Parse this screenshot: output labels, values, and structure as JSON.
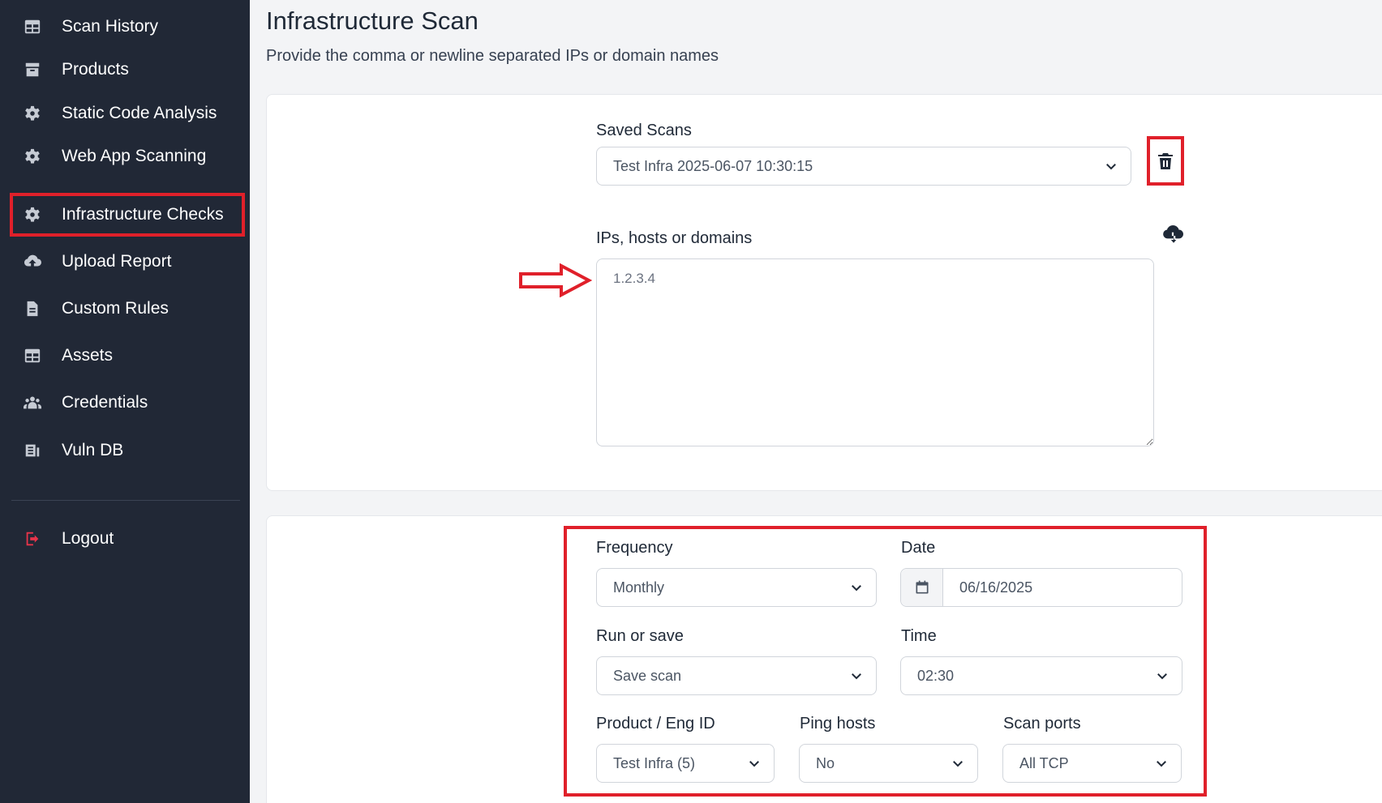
{
  "sidebar": {
    "items": [
      {
        "label": "Scan History",
        "icon": "table-icon"
      },
      {
        "label": "Products",
        "icon": "archive-icon"
      },
      {
        "label": "Static Code Analysis",
        "icon": "gear-icon"
      },
      {
        "label": "Web App Scanning",
        "icon": "gear-icon"
      },
      {
        "label": "Infrastructure Checks",
        "icon": "gear-icon",
        "active": true
      },
      {
        "label": "Upload Report",
        "icon": "cloud-upload-icon"
      },
      {
        "label": "Custom Rules",
        "icon": "file-icon"
      },
      {
        "label": "Assets",
        "icon": "table-icon"
      },
      {
        "label": "Credentials",
        "icon": "users-icon"
      },
      {
        "label": "Vuln DB",
        "icon": "database-icon"
      }
    ],
    "logout_label": "Logout"
  },
  "header": {
    "title": "Infrastructure Scan",
    "subtitle": "Provide the comma or newline separated IPs or domain names"
  },
  "target_form": {
    "saved_scans_label": "Saved Scans",
    "saved_scans_value": "Test Infra 2025-06-07 10:30:15",
    "targets_label": "IPs, hosts or domains",
    "targets_value": "1.2.3.4"
  },
  "schedule_form": {
    "frequency_label": "Frequency",
    "frequency_value": "Monthly",
    "date_label": "Date",
    "date_value": "06/16/2025",
    "run_or_save_label": "Run or save",
    "run_or_save_value": "Save scan",
    "time_label": "Time",
    "time_value": "02:30",
    "product_label": "Product / Eng ID",
    "product_value": "Test Infra (5)",
    "ping_label": "Ping hosts",
    "ping_value": "No",
    "ports_label": "Scan ports",
    "ports_value": "All TCP"
  },
  "colors": {
    "sidebar_bg": "#212836",
    "highlight": "#e0202a",
    "logout_icon": "#e8344a"
  }
}
